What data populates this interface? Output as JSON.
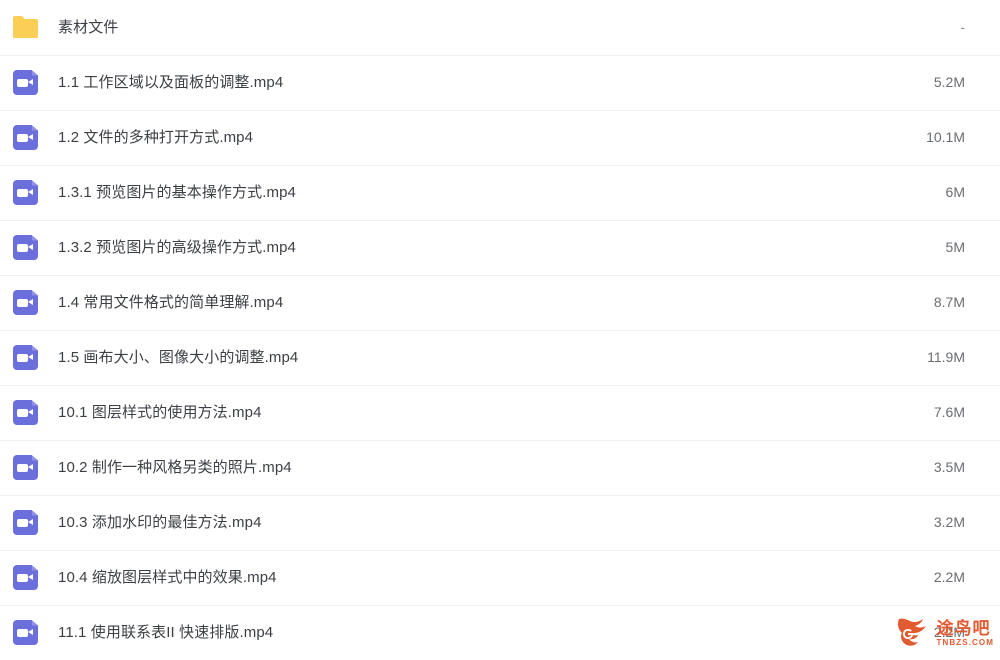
{
  "colors": {
    "folder_icon": "#FBCF55",
    "video_icon": "#6B6FDB",
    "row_divider": "#F1F1F3",
    "file_name_text": "#3C3F44",
    "file_size_text": "#6A6D72",
    "watermark": "#E2552A",
    "background": "#FFFFFF"
  },
  "file_list": {
    "rows": [
      {
        "icon": "folder-icon",
        "type": "folder",
        "name": "素材文件",
        "size": "-"
      },
      {
        "icon": "video-file-icon",
        "type": "video",
        "name": "1.1 工作区域以及面板的调整.mp4",
        "size": "5.2M"
      },
      {
        "icon": "video-file-icon",
        "type": "video",
        "name": "1.2 文件的多种打开方式.mp4",
        "size": "10.1M"
      },
      {
        "icon": "video-file-icon",
        "type": "video",
        "name": "1.3.1 预览图片的基本操作方式.mp4",
        "size": "6M"
      },
      {
        "icon": "video-file-icon",
        "type": "video",
        "name": "1.3.2 预览图片的高级操作方式.mp4",
        "size": "5M"
      },
      {
        "icon": "video-file-icon",
        "type": "video",
        "name": "1.4 常用文件格式的简单理解.mp4",
        "size": "8.7M"
      },
      {
        "icon": "video-file-icon",
        "type": "video",
        "name": "1.5 画布大小、图像大小的调整.mp4",
        "size": "11.9M"
      },
      {
        "icon": "video-file-icon",
        "type": "video",
        "name": "10.1 图层样式的使用方法.mp4",
        "size": "7.6M"
      },
      {
        "icon": "video-file-icon",
        "type": "video",
        "name": "10.2 制作一种风格另类的照片.mp4",
        "size": "3.5M"
      },
      {
        "icon": "video-file-icon",
        "type": "video",
        "name": "10.3 添加水印的最佳方法.mp4",
        "size": "3.2M"
      },
      {
        "icon": "video-file-icon",
        "type": "video",
        "name": "10.4 缩放图层样式中的效果.mp4",
        "size": "2.2M"
      },
      {
        "icon": "video-file-icon",
        "type": "video",
        "name": "11.1 使用联系表II 快速排版.mp4",
        "size": "2.2M"
      }
    ]
  },
  "watermark": {
    "icon": "bird-flame-logo-icon",
    "brand_cn": "途鸟吧",
    "brand_en": "TNBZS.COM"
  }
}
